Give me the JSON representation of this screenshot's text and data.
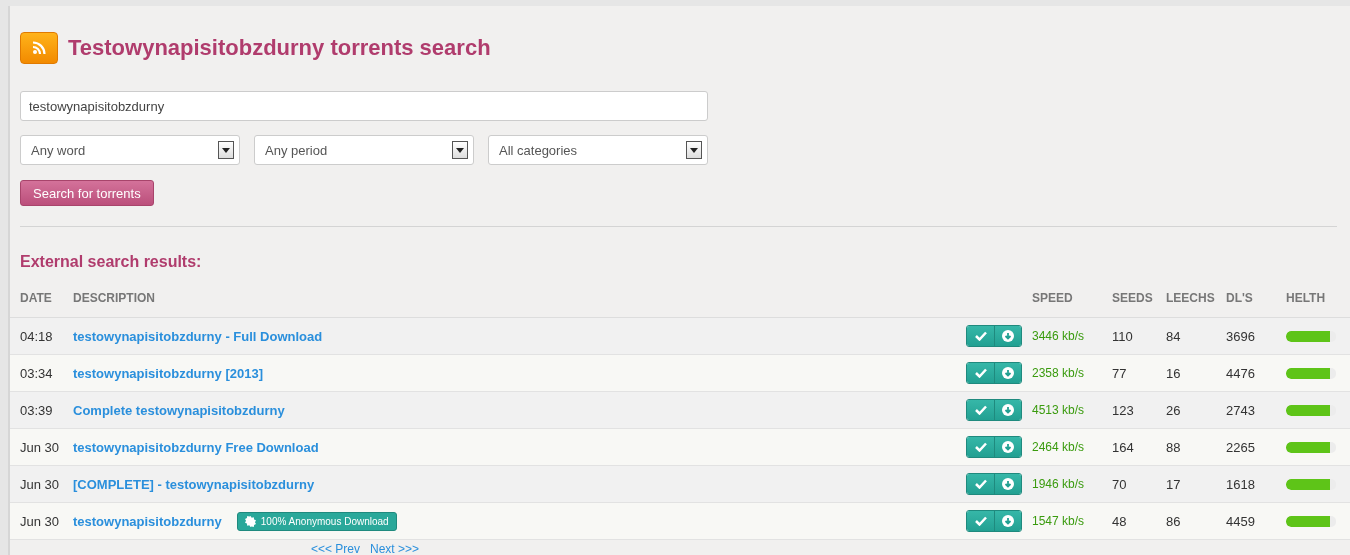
{
  "title": "Testowynapisitobzdurny torrents search",
  "search": {
    "value": "testowynapisitobzdurny"
  },
  "selects": [
    "Any word",
    "Any period",
    "All categories"
  ],
  "search_button": "Search for torrents",
  "results_heading": "External search results:",
  "columns": [
    "DATE",
    "DESCRIPTION",
    "SPEED",
    "SEEDS",
    "LEECHS",
    "DL'S",
    "HELTH"
  ],
  "rows": [
    {
      "date": "04:18",
      "description": "testowynapisitobzdurny - Full Download",
      "speed": "3446 kb/s",
      "seeds": "110",
      "leechs": "84",
      "dls": "3696",
      "level": 0.88
    },
    {
      "date": "03:34",
      "description": "testowynapisitobzdurny [2013]",
      "speed": "2358 kb/s",
      "seeds": "77",
      "leechs": "16",
      "dls": "4476",
      "level": 0.88
    },
    {
      "date": "03:39",
      "description": "Complete testowynapisitobzdurny",
      "speed": "4513 kb/s",
      "seeds": "123",
      "leechs": "26",
      "dls": "2743",
      "level": 0.88
    },
    {
      "date": "Jun 30",
      "description": "testowynapisitobzdurny Free Download",
      "speed": "2464 kb/s",
      "seeds": "164",
      "leechs": "88",
      "dls": "2265",
      "level": 0.88
    },
    {
      "date": "Jun 30",
      "description": "[COMPLETE] - testowynapisitobzdurny",
      "speed": "1946 kb/s",
      "seeds": "70",
      "leechs": "17",
      "dls": "1618",
      "level": 0.88
    },
    {
      "date": "Jun 30",
      "description": "testowynapisitobzdurny",
      "badge": "100% Anonymous Download",
      "speed": "1547 kb/s",
      "seeds": "48",
      "leechs": "86",
      "dls": "4459",
      "level": 0.88
    }
  ],
  "pagination": {
    "prev": "<<< Prev",
    "next": "Next >>>"
  }
}
